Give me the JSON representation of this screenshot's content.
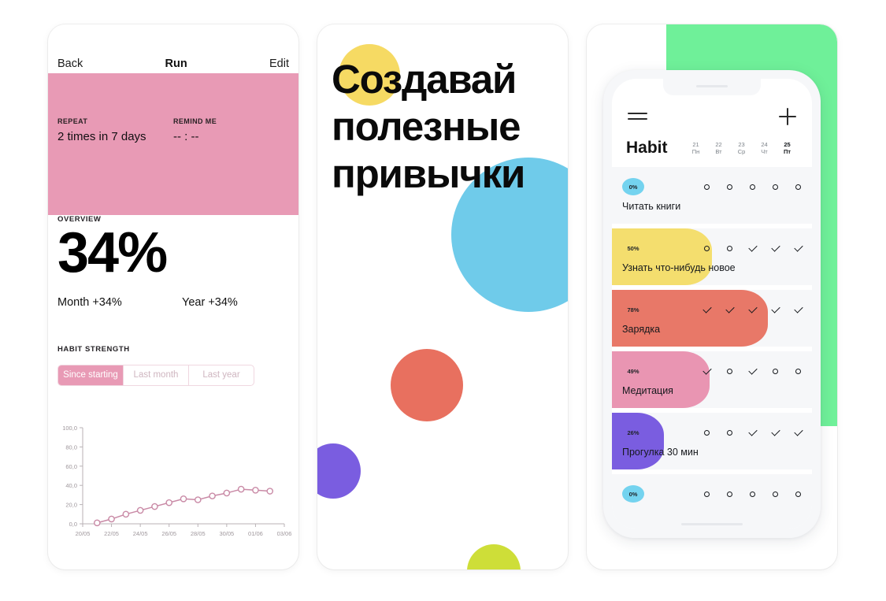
{
  "panel1": {
    "nav": {
      "back": "Back",
      "title": "Run",
      "edit": "Edit"
    },
    "meta": [
      {
        "label": "REPEAT",
        "value": "2 times in 7 days"
      },
      {
        "label": "REMIND ME",
        "value": "-- : --"
      }
    ],
    "overview_label": "OVERVIEW",
    "overview_value": "34%",
    "deltas": [
      "Month +34%",
      "Year +34%"
    ],
    "habit_strength_label": "HABIT STRENGTH",
    "segments": [
      {
        "label": "Since starting",
        "active": true
      },
      {
        "label": "Last month",
        "active": false
      },
      {
        "label": "Last year",
        "active": false
      }
    ],
    "colors": {
      "header_pink": "#e89ab5",
      "line": "#c98aa6"
    }
  },
  "chart_data": {
    "type": "line",
    "title": "",
    "xlabel": "",
    "ylabel": "",
    "grid": false,
    "legend": "none",
    "line_color": "#c98aa6",
    "marker": "open-circle",
    "ylim": [
      0,
      100
    ],
    "yticks": [
      "0,0",
      "20,0",
      "40,0",
      "60,0",
      "80,0",
      "100,0"
    ],
    "ytick_values": [
      0,
      20,
      40,
      60,
      80,
      100
    ],
    "xtick_labels": [
      "20/05",
      "22/05",
      "24/05",
      "26/05",
      "28/05",
      "30/05",
      "01/06",
      "03/06"
    ],
    "xlim": [
      "20/05",
      "03/06"
    ],
    "x": [
      "21/05",
      "22/05",
      "23/05",
      "24/05",
      "25/05",
      "26/05",
      "27/05",
      "28/05",
      "29/05",
      "30/05",
      "31/05",
      "01/06",
      "02/06"
    ],
    "values": [
      1,
      5,
      10,
      14,
      18,
      22,
      26,
      25,
      29,
      32,
      36,
      35,
      34
    ]
  },
  "panel2": {
    "heading_lines": [
      "Создавай",
      "полезные",
      "привычки"
    ],
    "blobs": [
      {
        "name": "yellow",
        "color": "#f6da63"
      },
      {
        "name": "blue",
        "color": "#6fcbea"
      },
      {
        "name": "red",
        "color": "#e8705f"
      },
      {
        "name": "purple",
        "color": "#7a5de0"
      },
      {
        "name": "lime",
        "color": "#cede38"
      }
    ]
  },
  "panel3": {
    "background_shape_color": "#6ff099",
    "app_title": "Habit",
    "menu_icon": "hamburger-icon",
    "add_icon": "plus-icon",
    "days": [
      {
        "num": "21",
        "name": "Пн",
        "today": false
      },
      {
        "num": "22",
        "name": "Вт",
        "today": false
      },
      {
        "num": "23",
        "name": "Ср",
        "today": false
      },
      {
        "num": "24",
        "name": "Чт",
        "today": false
      },
      {
        "num": "25",
        "name": "Пт",
        "today": true
      }
    ],
    "habits": [
      {
        "percent": "0%",
        "name": "Читать книги",
        "color": "#74d3ef",
        "fill_width": 0,
        "badge_round": true,
        "marks": [
          "o",
          "o",
          "o",
          "o",
          "o"
        ]
      },
      {
        "percent": "50%",
        "name": "Узнать что-нибудь новое",
        "color": "#f4de6e",
        "fill_width": 50,
        "badge_round": false,
        "marks": [
          "o",
          "o",
          "v",
          "v",
          "v"
        ]
      },
      {
        "percent": "78%",
        "name": "Зарядка",
        "color": "#e87868",
        "fill_width": 78,
        "badge_round": false,
        "marks": [
          "v",
          "v",
          "v",
          "v",
          "v"
        ]
      },
      {
        "percent": "49%",
        "name": "Медитация",
        "color": "#e995b2",
        "fill_width": 49,
        "badge_round": false,
        "marks": [
          "v",
          "o",
          "v",
          "o",
          "o"
        ]
      },
      {
        "percent": "26%",
        "name": "Прогулка 30 мин",
        "color": "#7a5de0",
        "fill_width": 26,
        "badge_round": false,
        "marks": [
          "o",
          "o",
          "v",
          "v",
          "v"
        ]
      },
      {
        "percent": "0%",
        "name": "",
        "color": "#74d3ef",
        "fill_width": 0,
        "badge_round": true,
        "marks": [
          "o",
          "o",
          "o",
          "o",
          "o"
        ]
      }
    ]
  }
}
